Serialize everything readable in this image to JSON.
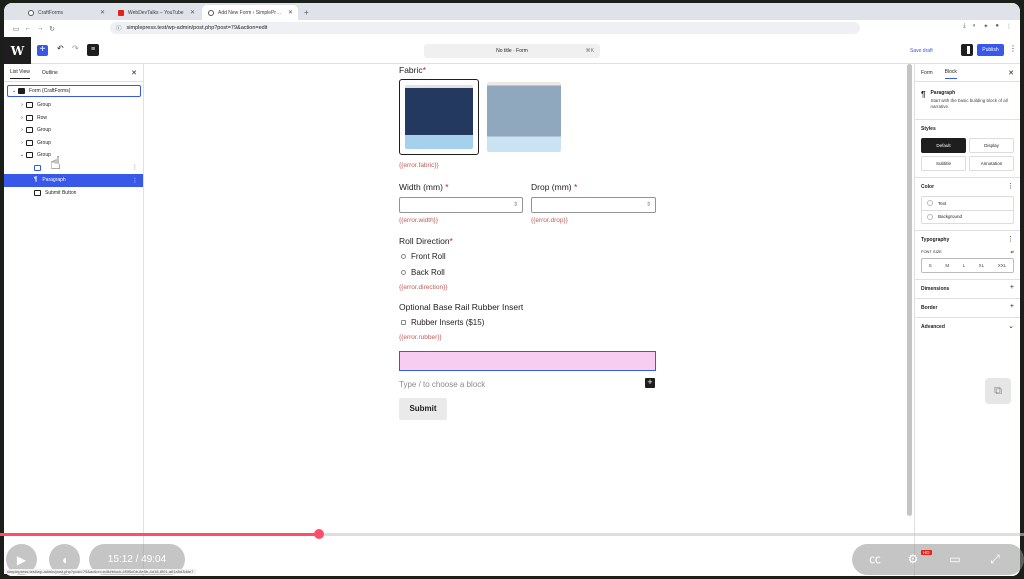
{
  "browser": {
    "tabs": [
      {
        "label": "CraftForms",
        "icon": "wordpress-icon",
        "active": false
      },
      {
        "label": "WebDevTalks – YouTube",
        "icon": "youtube-icon",
        "active": false
      },
      {
        "label": "Add New Form ‹ SimplePress — Wo",
        "icon": "wordpress-icon",
        "active": true
      }
    ],
    "url": "simplepress.test/wp-admin/post.php?post=79&action=edit",
    "status_url": "simplepress.test/wp-admin/post.php?post=79&action=edit#block-4f0f6d0b-8e5b-4d18-8f01-a61a5d3dde7"
  },
  "wp": {
    "doc_title": "No title · Form",
    "doc_shortcut": "⌘K",
    "save_draft": "Save draft",
    "publish": "Publish"
  },
  "listview": {
    "tabs": [
      "List View",
      "Outline"
    ],
    "items": [
      {
        "label": "Form (CraftForms)",
        "chev": "⌄",
        "level": 0
      },
      {
        "label": "Group",
        "chev": "›",
        "level": 1
      },
      {
        "label": "Row",
        "chev": "›",
        "level": 1
      },
      {
        "label": "Group",
        "chev": "›",
        "level": 1
      },
      {
        "label": "Group",
        "chev": "›",
        "level": 1
      },
      {
        "label": "Group",
        "chev": "⌄",
        "level": 1
      },
      {
        "label": "",
        "chev": "",
        "level": 2
      },
      {
        "label": "Paragraph",
        "chev": "",
        "level": 2
      },
      {
        "label": "Submit Button",
        "chev": "",
        "level": 2
      }
    ]
  },
  "form": {
    "fabric_label": "Fabric",
    "required_mark": "*",
    "error_fabric": "{{error.fabric}}",
    "width_label": "Width (mm)",
    "drop_label": "Drop (mm)",
    "error_width": "{{error.width}}",
    "error_drop": "{{error.drop}}",
    "direction_label": "Roll Direction",
    "direction_options": [
      "Front Roll",
      "Back Roll"
    ],
    "error_direction": "{{error.direction}}",
    "rubber_label": "Optional Base Rail Rubber Insert",
    "rubber_option": "Rubber Inserts ($15)",
    "error_rubber": "{{error.rubber}}",
    "block_placeholder": "Type / to choose a block",
    "submit": "Submit"
  },
  "sidebar": {
    "tabs": [
      "Form",
      "Block"
    ],
    "block_title": "Paragraph",
    "block_desc": "Start with the basic building block of all narrative.",
    "styles_heading": "Styles",
    "styles": [
      "Default",
      "Display",
      "Subtitle",
      "Annotation"
    ],
    "color_heading": "Color",
    "colors": [
      "Text",
      "Background"
    ],
    "typography_heading": "Typography",
    "font_size_label": "FONT SIZE",
    "sizes": [
      "S",
      "M",
      "L",
      "XL",
      "XXL"
    ],
    "dimensions": "Dimensions",
    "border": "Border",
    "advanced": "Advanced"
  },
  "player": {
    "time": "15:12 / 49:04",
    "progress": 0.312
  }
}
